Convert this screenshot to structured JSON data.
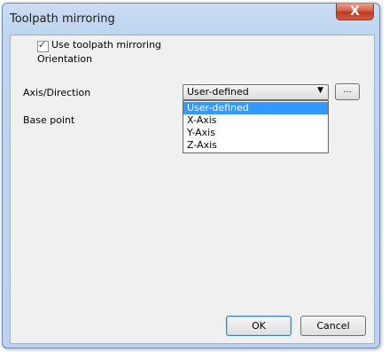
{
  "window": {
    "title": "Toolpath mirroring",
    "close_label": "X"
  },
  "form": {
    "use_mirroring_label": "Use toolpath mirroring",
    "use_mirroring_checked": true,
    "check_glyph": "✓",
    "orientation_label": "Orientation",
    "axis_direction_label": "Axis/Direction",
    "axis_direction_value": "User-defined",
    "combo_arrow": "▼",
    "browse_label": "...",
    "base_point_label": "Base point",
    "axis_options": [
      "User-defined",
      "X-Axis",
      "Y-Axis",
      "Z-Axis"
    ],
    "axis_selected_index": 0
  },
  "buttons": {
    "ok_label": "OK",
    "cancel_label": "Cancel"
  }
}
